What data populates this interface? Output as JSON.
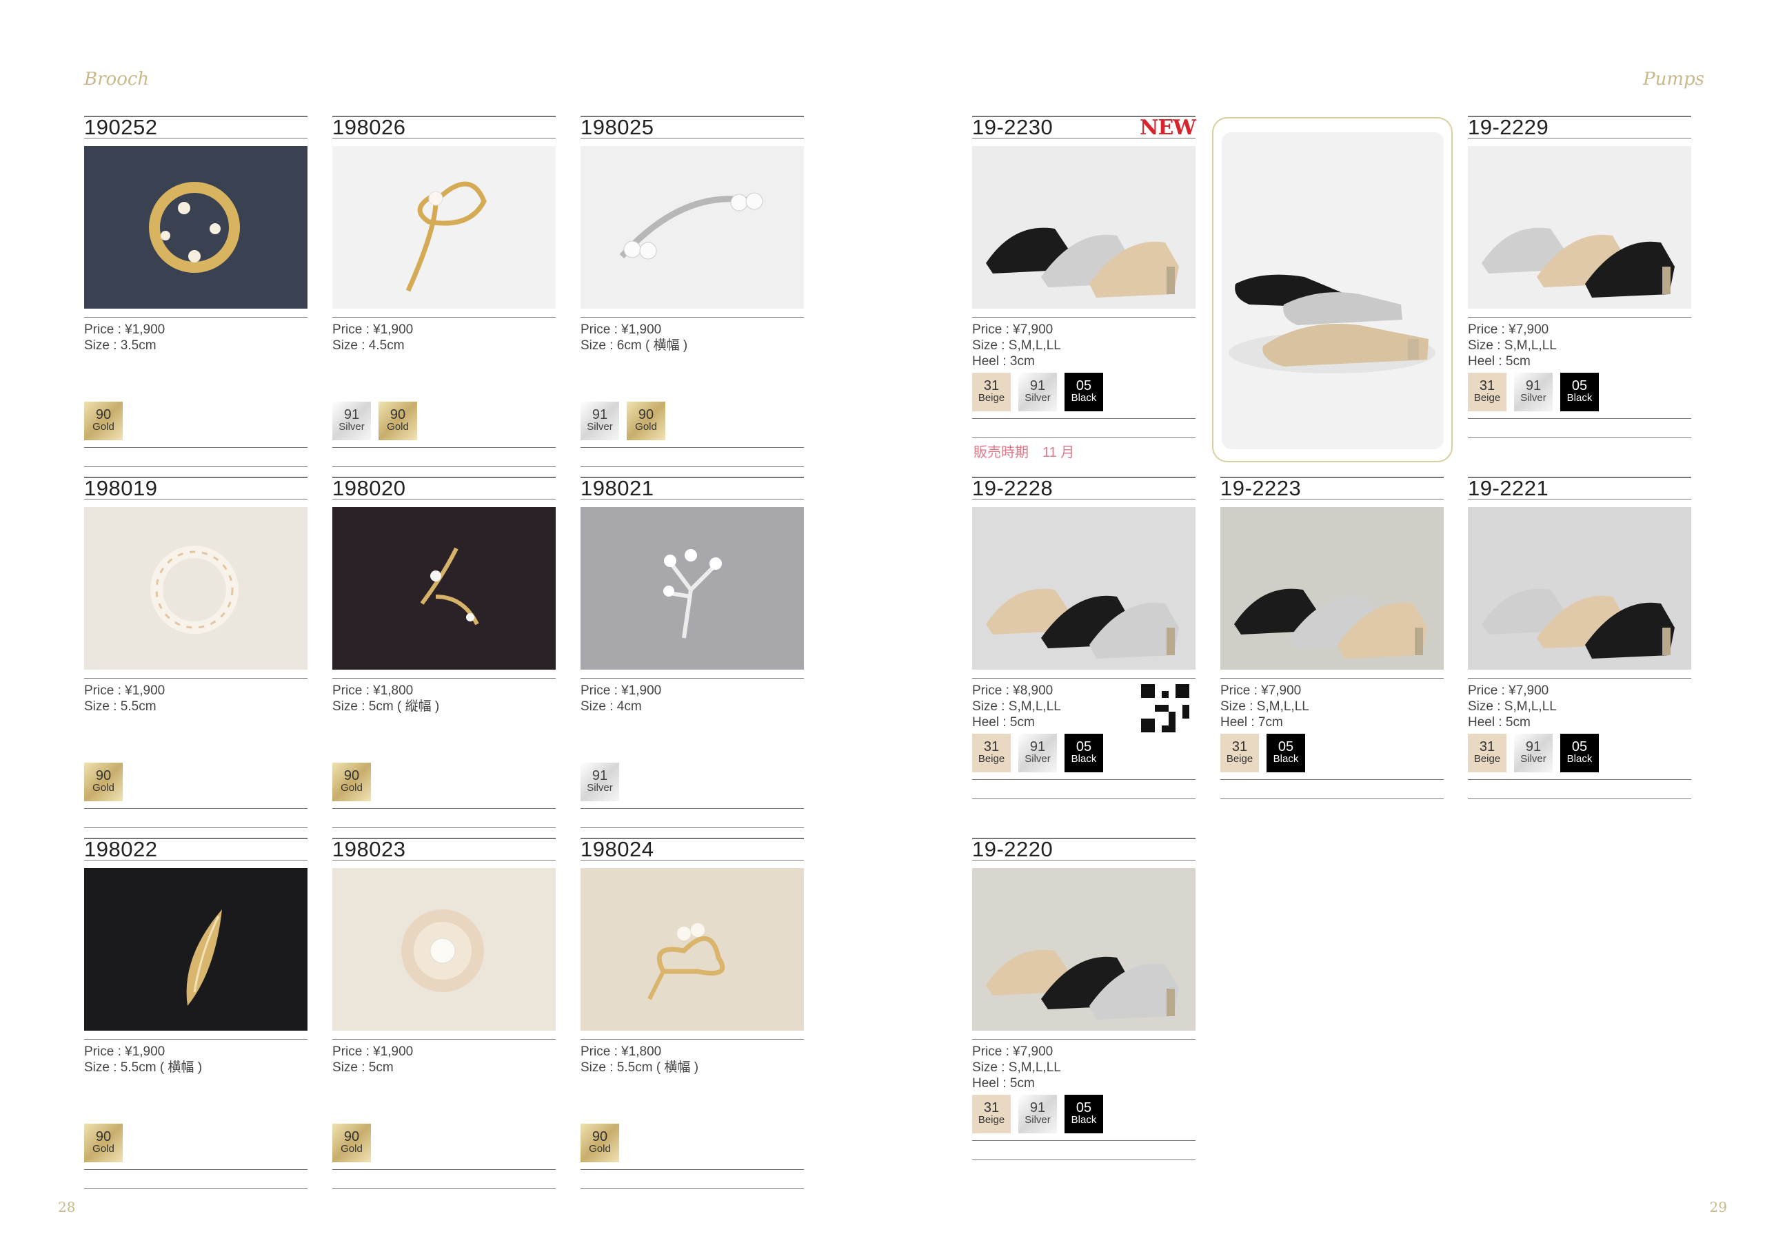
{
  "page": {
    "left_section_title": "Brooch",
    "right_section_title": "Pumps",
    "left_page_number": "28",
    "right_page_number": "29",
    "sale_period_note": "販売時期　11 月"
  },
  "brooches": [
    {
      "code": "190252",
      "price": "Price : ¥1,900",
      "size": "Size :  3.5cm",
      "heel": "",
      "colors": [
        {
          "code": "90",
          "name": "Gold",
          "tone": "gold"
        }
      ]
    },
    {
      "code": "198026",
      "price": "Price : ¥1,900",
      "size": "Size :  4.5cm",
      "heel": "",
      "colors": [
        {
          "code": "91",
          "name": "Silver",
          "tone": "silver"
        },
        {
          "code": "90",
          "name": "Gold",
          "tone": "gold"
        }
      ]
    },
    {
      "code": "198025",
      "price": "Price : ¥1,900",
      "size": "Size : 6cm ( 横幅 )",
      "heel": "",
      "colors": [
        {
          "code": "91",
          "name": "Silver",
          "tone": "silver"
        },
        {
          "code": "90",
          "name": "Gold",
          "tone": "gold"
        }
      ]
    },
    {
      "code": "198019",
      "price": "Price : ¥1,900",
      "size": "Size :  5.5cm",
      "heel": "",
      "colors": [
        {
          "code": "90",
          "name": "Gold",
          "tone": "gold"
        }
      ]
    },
    {
      "code": "198020",
      "price": "Price : ¥1,800",
      "size": "Size : 5cm ( 縦幅 )",
      "heel": "",
      "colors": [
        {
          "code": "90",
          "name": "Gold",
          "tone": "gold"
        }
      ]
    },
    {
      "code": "198021",
      "price": "Price : ¥1,900",
      "size": "Size : 4cm",
      "heel": "",
      "colors": [
        {
          "code": "91",
          "name": "Silver",
          "tone": "silver"
        }
      ]
    },
    {
      "code": "198022",
      "price": "Price : ¥1,900",
      "size": "Size : 5.5cm ( 横幅 )",
      "heel": "",
      "colors": [
        {
          "code": "90",
          "name": "Gold",
          "tone": "gold"
        }
      ]
    },
    {
      "code": "198023",
      "price": "Price : ¥1,900",
      "size": "Size : 5cm",
      "heel": "",
      "colors": [
        {
          "code": "90",
          "name": "Gold",
          "tone": "gold"
        }
      ]
    },
    {
      "code": "198024",
      "price": "Price : ¥1,800",
      "size": "Size : 5.5cm ( 横幅 )",
      "heel": "",
      "colors": [
        {
          "code": "90",
          "name": "Gold",
          "tone": "gold"
        }
      ]
    }
  ],
  "pumps": [
    {
      "code": "19-2230",
      "badge": "NEW",
      "price": "Price : ¥7,900",
      "size": "Size : S,M,L,LL",
      "heel": "Heel : 3cm",
      "colors": [
        {
          "code": "31",
          "name": "Beige",
          "tone": "beige"
        },
        {
          "code": "91",
          "name": "Silver",
          "tone": "silver"
        },
        {
          "code": "05",
          "name": "Black",
          "tone": "black"
        }
      ]
    },
    {
      "code": "19-2229",
      "badge": "",
      "price": "Price : ¥7,900",
      "size": "Size : S,M,L,LL",
      "heel": "Heel : 5cm",
      "colors": [
        {
          "code": "31",
          "name": "Beige",
          "tone": "beige"
        },
        {
          "code": "91",
          "name": "Silver",
          "tone": "silver"
        },
        {
          "code": "05",
          "name": "Black",
          "tone": "black"
        }
      ]
    },
    {
      "code": "19-2228",
      "badge": "",
      "price": "Price : ¥8,900",
      "size": "Size : S,M,L,LL",
      "heel": "Heel : 5cm",
      "colors": [
        {
          "code": "31",
          "name": "Beige",
          "tone": "beige"
        },
        {
          "code": "91",
          "name": "Silver",
          "tone": "silver"
        },
        {
          "code": "05",
          "name": "Black",
          "tone": "black"
        }
      ]
    },
    {
      "code": "19-2223",
      "badge": "",
      "price": "Price : ¥7,900",
      "size": "Size : S,M,L,LL",
      "heel": "Heel : 7cm",
      "colors": [
        {
          "code": "31",
          "name": "Beige",
          "tone": "beige"
        },
        {
          "code": "05",
          "name": "Black",
          "tone": "black"
        }
      ]
    },
    {
      "code": "19-2221",
      "badge": "",
      "price": "Price : ¥7,900",
      "size": "Size : S,M,L,LL",
      "heel": "Heel : 5cm",
      "colors": [
        {
          "code": "31",
          "name": "Beige",
          "tone": "beige"
        },
        {
          "code": "91",
          "name": "Silver",
          "tone": "silver"
        },
        {
          "code": "05",
          "name": "Black",
          "tone": "black"
        }
      ]
    },
    {
      "code": "19-2220",
      "badge": "",
      "price": "Price : ¥7,900",
      "size": "Size : S,M,L,LL",
      "heel": "Heel : 5cm",
      "colors": [
        {
          "code": "31",
          "name": "Beige",
          "tone": "beige"
        },
        {
          "code": "91",
          "name": "Silver",
          "tone": "silver"
        },
        {
          "code": "05",
          "name": "Black",
          "tone": "black"
        }
      ]
    }
  ]
}
